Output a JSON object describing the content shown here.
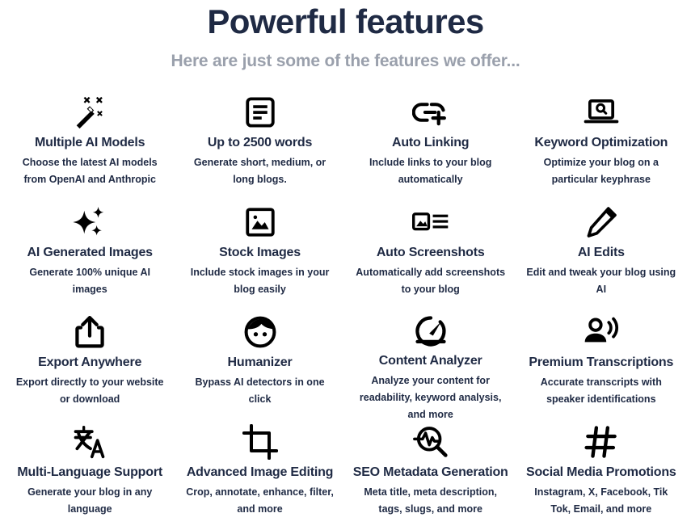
{
  "header": {
    "title": "Powerful features",
    "subtitle": "Here are just some of the features we offer..."
  },
  "colors": {
    "heading": "#1f2a44",
    "subtitle": "#9aa0ac",
    "text": "#1f2a44",
    "background": "#ffffff",
    "icon": "#000000"
  },
  "features": [
    {
      "icon": "magic-wand-icon",
      "title": "Multiple AI Models",
      "description": "Choose the latest AI models from OpenAI and Anthropic"
    },
    {
      "icon": "document-lines-icon",
      "title": "Up to 2500 words",
      "description": "Generate short, medium, or long blogs."
    },
    {
      "icon": "link-plus-icon",
      "title": "Auto Linking",
      "description": "Include links to your blog automatically"
    },
    {
      "icon": "laptop-search-icon",
      "title": "Keyword Optimization",
      "description": "Optimize your blog on a particular keyphrase"
    },
    {
      "icon": "sparkles-icon",
      "title": "AI Generated Images",
      "description": "Generate 100% unique AI images"
    },
    {
      "icon": "photo-icon",
      "title": "Stock Images",
      "description": "Include stock images in your blog easily"
    },
    {
      "icon": "photo-list-icon",
      "title": "Auto Screenshots",
      "description": "Automatically add screenshots to your blog"
    },
    {
      "icon": "pencil-icon",
      "title": "AI Edits",
      "description": "Edit and tweak your blog using AI"
    },
    {
      "icon": "share-export-icon",
      "title": "Export Anywhere",
      "description": "Export directly to your website or download"
    },
    {
      "icon": "face-icon",
      "title": "Humanizer",
      "description": "Bypass AI detectors in one click"
    },
    {
      "icon": "gauge-icon",
      "title": "Content Analyzer",
      "description": "Analyze your content for readability, keyword analysis, and more"
    },
    {
      "icon": "person-speaking-icon",
      "title": "Premium Transcriptions",
      "description": "Accurate transcripts with speaker identifications"
    },
    {
      "icon": "translate-icon",
      "title": "Multi-Language Support",
      "description": "Generate your blog in any language"
    },
    {
      "icon": "crop-icon",
      "title": "Advanced Image Editing",
      "description": "Crop, annotate, enhance, filter, and more"
    },
    {
      "icon": "search-pulse-icon",
      "title": "SEO Metadata Generation",
      "description": "Meta title, meta description, tags, slugs, and more"
    },
    {
      "icon": "hashtag-icon",
      "title": "Social Media Promotions",
      "description": "Instagram, X, Facebook, Tik Tok, Email, and more"
    }
  ]
}
